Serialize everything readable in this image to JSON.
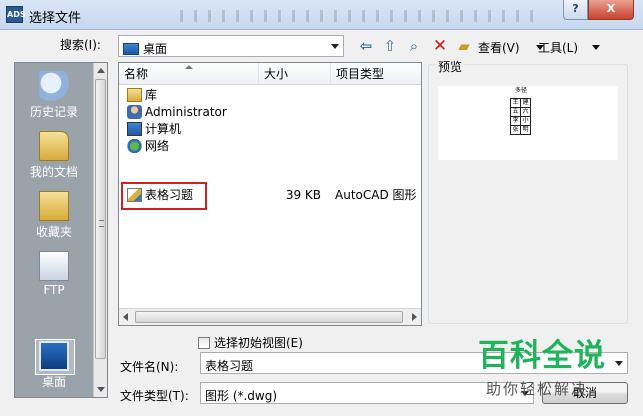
{
  "titlebar": {
    "app_icon_text": "ADS",
    "title": "选择文件",
    "help": "?",
    "close": "X"
  },
  "toolbar": {
    "search_label": "搜索(I):",
    "location": "桌面",
    "view_label": "查看(V)",
    "tools_label": "工具(L)",
    "icons": [
      "back-icon",
      "up-folder-icon",
      "search-icon",
      "delete-icon",
      "new-folder-icon"
    ]
  },
  "places": [
    {
      "label": "历史记录",
      "icon": "history-icon"
    },
    {
      "label": "我的文档",
      "icon": "folder-icon"
    },
    {
      "label": "收藏夹",
      "icon": "favorites-icon"
    },
    {
      "label": "FTP",
      "icon": "ftp-icon"
    },
    {
      "label": "桌面",
      "icon": "desktop-icon",
      "selected": true
    }
  ],
  "filelist": {
    "columns": [
      "名称",
      "大小",
      "项目类型"
    ],
    "rows": [
      {
        "name": "库",
        "size": "",
        "type": "",
        "icon": "library-icon"
      },
      {
        "name": "Administrator",
        "size": "",
        "type": "",
        "icon": "user-icon"
      },
      {
        "name": "计算机",
        "size": "",
        "type": "",
        "icon": "computer-icon"
      },
      {
        "name": "网络",
        "size": "",
        "type": "",
        "icon": "network-icon"
      },
      {
        "name": "表格习题",
        "size": "39 KB",
        "type": "AutoCAD 图形",
        "icon": "dwg-icon",
        "highlighted": true
      }
    ]
  },
  "preview": {
    "label": "预览",
    "thumb_header": "多径",
    "thumb_cells": [
      [
        "王",
        "建"
      ],
      [
        "五",
        "六"
      ],
      [
        "李",
        "小"
      ],
      [
        "张",
        "明"
      ]
    ]
  },
  "initial_view": {
    "label": "选择初始视图(E)",
    "checked": false
  },
  "filename": {
    "label": "文件名(N):",
    "value": "表格习题"
  },
  "filetype": {
    "label": "文件类型(T):",
    "value": "图形 (*.dwg)"
  },
  "buttons": {
    "cancel": "取消"
  },
  "watermark": {
    "title": "百科全说",
    "subtitle": "助你轻松解决"
  },
  "colors": {
    "highlight_box": "#d02020",
    "watermark_green": "#1db45a"
  }
}
